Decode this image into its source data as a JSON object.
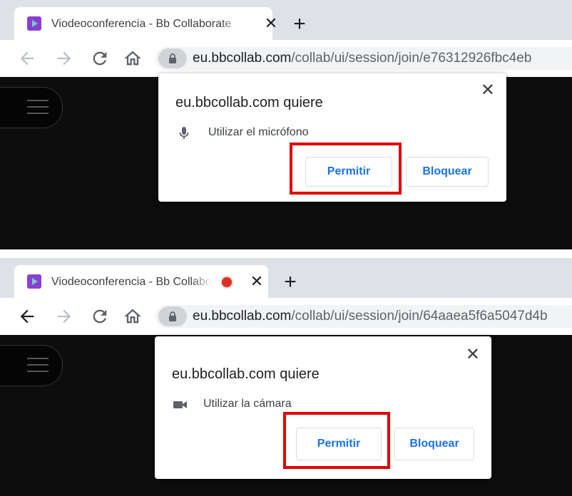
{
  "colors": {
    "highlight": "#e00000",
    "button_text": "#1a73e8",
    "recording": "#d93025",
    "favicon": "#8a3fd1"
  },
  "panels": [
    {
      "tab": {
        "title": "Viodeoconferencia - Bb Collaborate",
        "close": "✕"
      },
      "new_tab": "+",
      "address": {
        "host": "eu.bbcollab.com",
        "path": "/collab/ui/session/join/e76312926fbc4eb"
      },
      "dialog": {
        "title": "eu.bbcollab.com quiere",
        "close": "✕",
        "permission_icon": "microphone-icon",
        "permission_text": "Utilizar el micrófono",
        "allow_label": "Permitir",
        "block_label": "Bloquear"
      }
    },
    {
      "tab": {
        "title": "Viodeoconferencia - Bb Collaborate",
        "close": "✕",
        "recording_indicator": "recording-icon"
      },
      "new_tab": "+",
      "address": {
        "host": "eu.bbcollab.com",
        "path": "/collab/ui/session/join/64aaea5f6a5047d4b"
      },
      "dialog": {
        "title": "eu.bbcollab.com quiere",
        "close": "✕",
        "permission_icon": "video-camera-icon",
        "permission_text": "Utilizar la cámara",
        "allow_label": "Permitir",
        "block_label": "Bloquear"
      }
    }
  ]
}
